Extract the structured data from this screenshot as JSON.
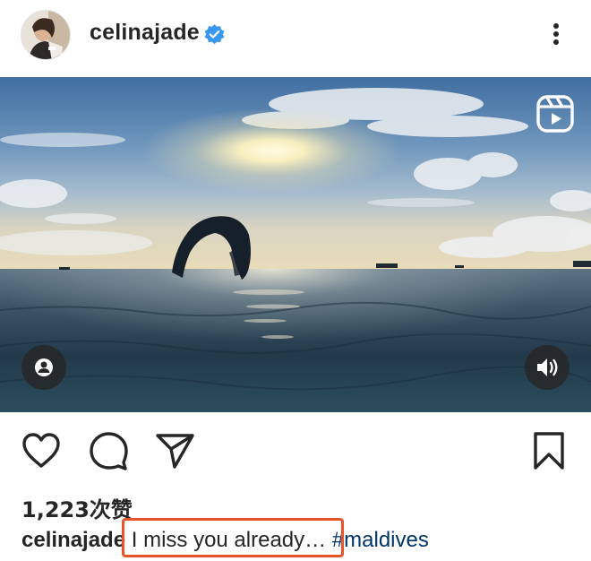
{
  "post": {
    "username": "celinajade",
    "verified": true,
    "likes_text": "1,223次赞",
    "caption": {
      "username": "celinajade",
      "text": "I miss you already…",
      "hashtag": "#maldives"
    }
  },
  "icons": {
    "verified": "verified-badge-icon",
    "more": "more-vertical-icon",
    "reels": "reels-icon",
    "tag": "user-tag-icon",
    "volume": "volume-icon",
    "like": "heart-icon",
    "comment": "comment-icon",
    "share": "share-icon",
    "save": "bookmark-icon"
  },
  "colors": {
    "text": "#262626",
    "verified": "#3897f0",
    "hashtag": "#00376b",
    "highlight": "#e8542a"
  }
}
